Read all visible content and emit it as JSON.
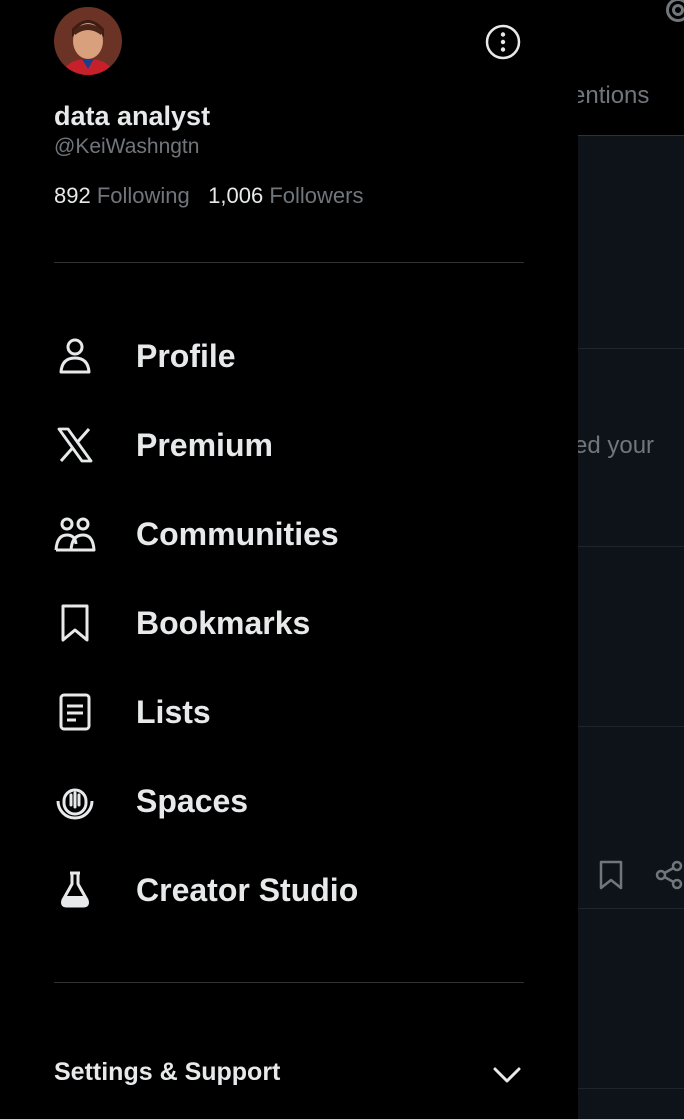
{
  "profile": {
    "display_name": "data analyst",
    "handle": "@KeiWashngtn",
    "following_count": "892",
    "following_label": "Following",
    "followers_count": "1,006",
    "followers_label": "Followers"
  },
  "menu": [
    {
      "label": "Profile",
      "icon": "person-icon"
    },
    {
      "label": "Premium",
      "icon": "x-logo-icon"
    },
    {
      "label": "Communities",
      "icon": "communities-icon"
    },
    {
      "label": "Bookmarks",
      "icon": "bookmark-icon"
    },
    {
      "label": "Lists",
      "icon": "list-icon"
    },
    {
      "label": "Spaces",
      "icon": "spaces-icon"
    },
    {
      "label": "Creator Studio",
      "icon": "flask-icon"
    }
  ],
  "settings_support_label": "Settings & Support",
  "background": {
    "tab_text": "entions",
    "snippet_text": "ed your"
  },
  "colors": {
    "background": "#000000",
    "primary_text": "#e7e9ea",
    "secondary_text": "#71767b",
    "divider": "#2f3336"
  }
}
